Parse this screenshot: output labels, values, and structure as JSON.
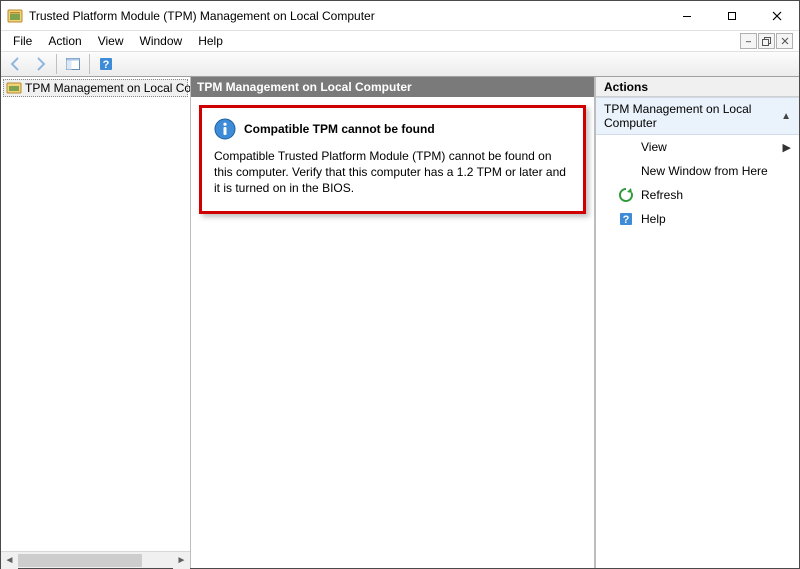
{
  "titlebar": {
    "title": "Trusted Platform Module (TPM) Management on Local Computer"
  },
  "menu": {
    "items": [
      "File",
      "Action",
      "View",
      "Window",
      "Help"
    ]
  },
  "tree": {
    "root_label": "TPM Management on Local Comp"
  },
  "center": {
    "header": "TPM Management on Local Computer",
    "alert_title": "Compatible TPM cannot be found",
    "alert_body": "Compatible Trusted Platform Module (TPM) cannot be found on this computer. Verify that this computer has a 1.2 TPM or later and it is turned on in the BIOS."
  },
  "actions": {
    "header": "Actions",
    "group_title": "TPM Management on Local Computer",
    "items": [
      {
        "label": "View",
        "icon": "none",
        "submenu": true
      },
      {
        "label": "New Window from Here",
        "icon": "none",
        "submenu": false
      },
      {
        "label": "Refresh",
        "icon": "refresh",
        "submenu": false
      },
      {
        "label": "Help",
        "icon": "help",
        "submenu": false
      }
    ]
  }
}
